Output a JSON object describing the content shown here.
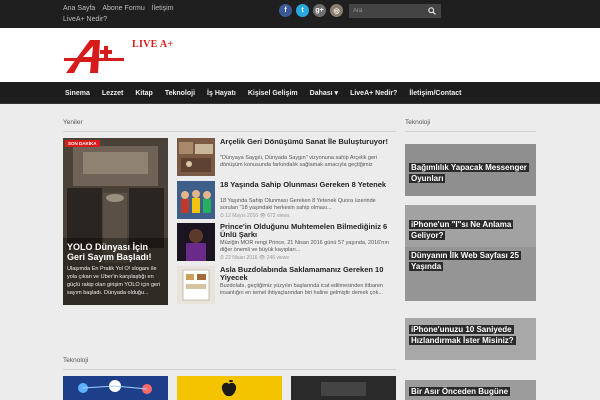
{
  "topbar": {
    "links": [
      "Ana Sayfa",
      "Abone Formu",
      "İletişim",
      "LiveA+ Nedir?"
    ],
    "social": [
      {
        "icon": "facebook-icon",
        "glyph": "f",
        "color": "#3b5998"
      },
      {
        "icon": "twitter-icon",
        "glyph": "t",
        "color": "#29a8e0"
      },
      {
        "icon": "google-plus-icon",
        "glyph": "g+",
        "color": "#6d6d6d"
      },
      {
        "icon": "instagram-icon",
        "glyph": "◎",
        "color": "#8a7f6f"
      }
    ],
    "search_placeholder": "Ara"
  },
  "header": {
    "logo_text": "LIVE A+",
    "brand_color": "#d61b1b"
  },
  "nav": {
    "items": [
      "Sinema",
      "Lezzet",
      "Kitap",
      "Teknoloji",
      "İş Hayatı",
      "Kişisel Gelişim",
      "Dahası ▾",
      "LiveA+ Nedir?",
      "İletişim/Contact"
    ]
  },
  "main": {
    "section_title": "Yeniler",
    "featured": {
      "badge": "SON DAKİKA",
      "title": "YOLO Dünyası İçin Geri Sayım Başladı!",
      "excerpt": "Ulaşımda En Pratik Yol O!  sloganı ile yola çıkan ve Uber'in karşılaştığı en güçlü rakip olan girişim YOLO için geri sayım başladı. Dünyada olduğu..."
    },
    "articles": [
      {
        "title": "Arçelik Geri Dönüşümü Sanat İle Buluşturuyor!",
        "excerpt": "\"Dünyaya Saygılı, Dünyada Saygın\" vizyonuna sahip Arçelik geri dönüşüm  konusunda farkındalık sağlamak amacıyla geçtiğimiz günlerde çok...",
        "meta": ""
      },
      {
        "title": "18 Yaşında Sahip Olunması Gereken 8 Yetenek",
        "excerpt": "18 Yaşında Sahip Olunması Gereken 8 Yetenek   Quora üzerinde sorulan \"18 yaşındaki herkesin sahip olması...",
        "meta": "⏱ 12 Mayıs 2016 👁 672 views"
      },
      {
        "title": "Prince'in Olduğunu Muhtemelen Bilmediğiniz 6 Ünlü Şarkı",
        "excerpt": "Müziğin MOR rengi Prince, 21 Nisan 2016 günü 57 yaşında, 2016'nın diğer önemli ve büyük kayıpları...",
        "meta": "⏱ 22 Nisan 2016 👁 246 views"
      },
      {
        "title": "Asla Buzdolabında Saklamamanız Gereken 10 Yiyecek",
        "excerpt": "  Buzdolabı, geçtiğimiz yüzyılın başlarında icat edilmesinden itibaren insanlığın en temel ihtiyaçlarından biri haline gelmiştir demek çok...",
        "meta": ""
      }
    ]
  },
  "sidebar": {
    "title": "Teknoloji",
    "cards": [
      {
        "title": "Bağımlılık Yapacak Messenger Oyunları"
      },
      {
        "title": "iPhone'un \"I\"sı Ne Anlama Geliyor?"
      },
      {
        "title": "Dünyanın İlk Web Sayfası 25 Yaşında"
      },
      {
        "title": "iPhone'unuzu 10 Saniyede Hızlandırmak İster Misiniz?"
      },
      {
        "title": "Bir Asır Önceden Bugüne"
      }
    ]
  },
  "bottom": {
    "section_title": "Teknoloji"
  }
}
